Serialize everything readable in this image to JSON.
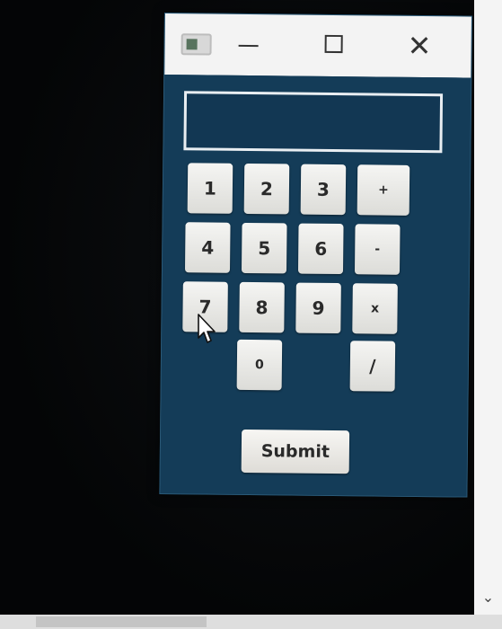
{
  "window": {
    "controls": {
      "minimize": "minimize-icon",
      "maximize": "maximize-icon",
      "close": "close-icon"
    },
    "app_icon": "window-app-icon"
  },
  "display": {
    "value": ""
  },
  "keypad": {
    "keys": [
      {
        "label": "1"
      },
      {
        "label": "2"
      },
      {
        "label": "3"
      },
      {
        "label": "+"
      },
      {
        "label": "4"
      },
      {
        "label": "5"
      },
      {
        "label": "6"
      },
      {
        "label": "-"
      },
      {
        "label": "7"
      },
      {
        "label": "8"
      },
      {
        "label": "9"
      },
      {
        "label": "x"
      },
      {
        "label": "0"
      },
      {
        "label": "/"
      }
    ]
  },
  "submit": {
    "label": "Submit"
  },
  "colors": {
    "window_background": "#143c58",
    "display_border": "#e9eef2",
    "key_background": "#ebebe8"
  }
}
